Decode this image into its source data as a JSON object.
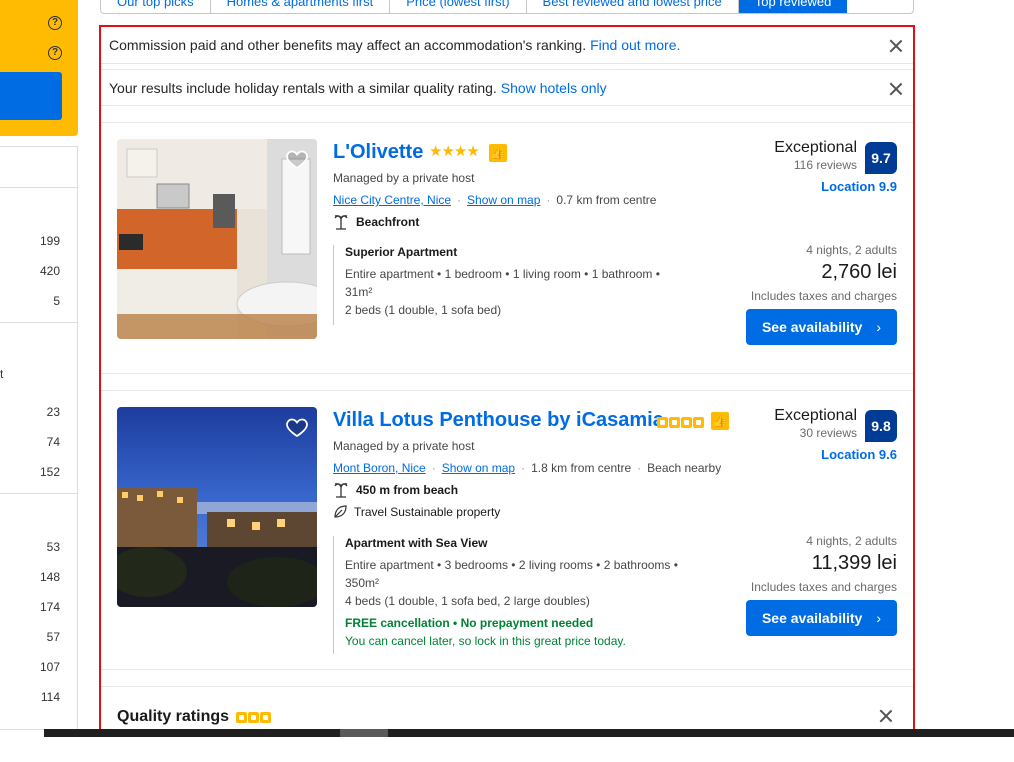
{
  "sort_tabs": [
    {
      "label": "Our top picks",
      "active": false
    },
    {
      "label": "Homes & apartments first",
      "active": false
    },
    {
      "label": "Price (lowest first)",
      "active": false
    },
    {
      "label": "Best reviewed and lowest price",
      "active": false
    },
    {
      "label": "Top reviewed",
      "active": true
    }
  ],
  "sidebar": {
    "counts_group1": [
      "199",
      "420",
      "5"
    ],
    "fragment_t": "t",
    "counts_group2": [
      "23",
      "74",
      "152"
    ],
    "counts_group3": [
      "53",
      "148",
      "174",
      "57",
      "107",
      "114"
    ]
  },
  "notices": {
    "commission": {
      "text": "Commission paid and other benefits may affect an accommodation's ranking.",
      "link": "Find out more."
    },
    "holiday": {
      "text": "Your results include holiday rentals with a similar quality rating.",
      "link": "Show hotels only"
    }
  },
  "cards": [
    {
      "name": "L'Olivette",
      "stars": "★★★★",
      "thumb": "👍",
      "managed": "Managed by a private host",
      "area": "Nice City Centre, Nice",
      "show_map": "Show on map",
      "distance": "0.7 km from centre",
      "feature": "Beachfront",
      "unit_title": "Superior Apartment",
      "unit_line1": "Entire apartment • 1 bedroom • 1 living room • 1 bathroom •",
      "unit_line2": "31m²",
      "unit_line3": "2 beds (1 double, 1 sofa bed)",
      "review_word": "Exceptional",
      "review_count": "116 reviews",
      "score": "9.7",
      "location_score": "Location 9.9",
      "nights": "4 nights, 2 adults",
      "price": "2,760 lei",
      "taxes": "Includes taxes and charges",
      "button": "See availability"
    },
    {
      "name": "Villa Lotus Penthouse by iCasamia",
      "thumb": "👍",
      "managed": "Managed by a private host",
      "area": "Mont Boron, Nice",
      "show_map": "Show on map",
      "distance": "1.8 km from centre",
      "beach": "Beach nearby",
      "feature": "450 m from beach",
      "sustainable": "Travel Sustainable property",
      "unit_title": "Apartment with Sea View",
      "unit_line1": "Entire apartment • 3 bedrooms • 2 living rooms • 2 bathrooms •",
      "unit_line2": "350m²",
      "unit_line3": "4 beds (1 double, 1 sofa bed, 2 large doubles)",
      "free_cancel": "FREE cancellation • No prepayment needed",
      "cancel_later": "You can cancel later, so lock in this great price today.",
      "review_word": "Exceptional",
      "review_count": "30 reviews",
      "score": "9.8",
      "location_score": "Location 9.6",
      "nights": "4 nights, 2 adults",
      "price": "11,399 lei",
      "taxes": "Includes taxes and charges",
      "button": "See availability"
    }
  ],
  "quality": {
    "title": "Quality ratings"
  },
  "colors": {
    "brand_blue": "#006ce4",
    "score_navy": "#003b95",
    "yellow": "#febb02",
    "green": "#008234",
    "red_outline": "#e21111"
  }
}
